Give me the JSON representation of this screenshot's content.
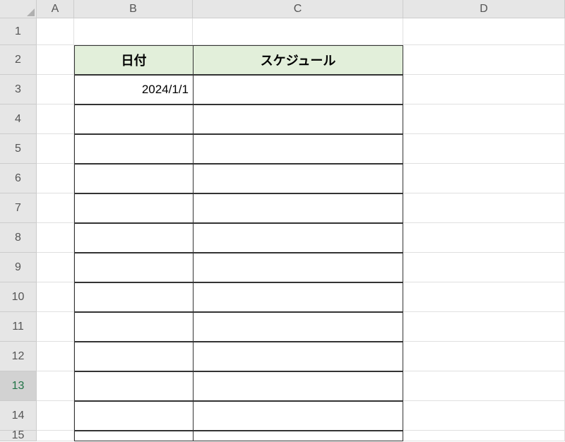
{
  "columns": {
    "a": "A",
    "b": "B",
    "c": "C",
    "d": "D"
  },
  "rows": {
    "r1": "1",
    "r2": "2",
    "r3": "3",
    "r4": "4",
    "r5": "5",
    "r6": "6",
    "r7": "7",
    "r8": "8",
    "r9": "9",
    "r10": "10",
    "r11": "11",
    "r12": "12",
    "r13": "13",
    "r14": "14",
    "r15": "15"
  },
  "table": {
    "header_date": "日付",
    "header_schedule": "スケジュール",
    "date_value": "2024/1/1"
  }
}
